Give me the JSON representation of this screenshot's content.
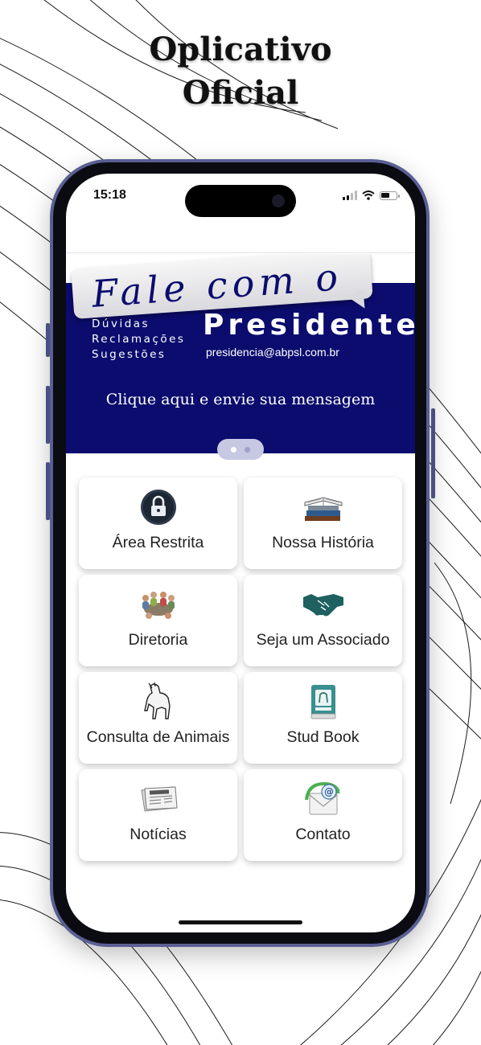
{
  "headline": {
    "line1": "Oplicativo",
    "line2": "Oficial"
  },
  "status_bar": {
    "time": "15:18"
  },
  "banner": {
    "title": "Fale com o",
    "subtitles": [
      "Dúvidas",
      "Reclamações",
      "Sugestões"
    ],
    "heading": "Presidente",
    "email": "presidencia@abpsl.com.br",
    "cta": "Clique aqui e envie sua mensagem",
    "background_color": "#0b0c6e",
    "pager": {
      "count": 2,
      "active_index": 0
    }
  },
  "menu": {
    "items": [
      {
        "label": "Área Restrita",
        "icon": "lock-icon"
      },
      {
        "label": "Nossa História",
        "icon": "books-icon"
      },
      {
        "label": "Diretoria",
        "icon": "meeting-table-icon"
      },
      {
        "label": "Seja um Associado",
        "icon": "handshake-icon"
      },
      {
        "label": "Consulta de Animais",
        "icon": "horse-icon"
      },
      {
        "label": "Stud Book",
        "icon": "stud-book-icon"
      },
      {
        "label": "Notícias",
        "icon": "newspaper-icon"
      },
      {
        "label": "Contato",
        "icon": "email-icon"
      }
    ]
  },
  "colors": {
    "phone_frame": "#5a5f93",
    "banner": "#0b0c6e",
    "handshake": "#1f6060"
  }
}
